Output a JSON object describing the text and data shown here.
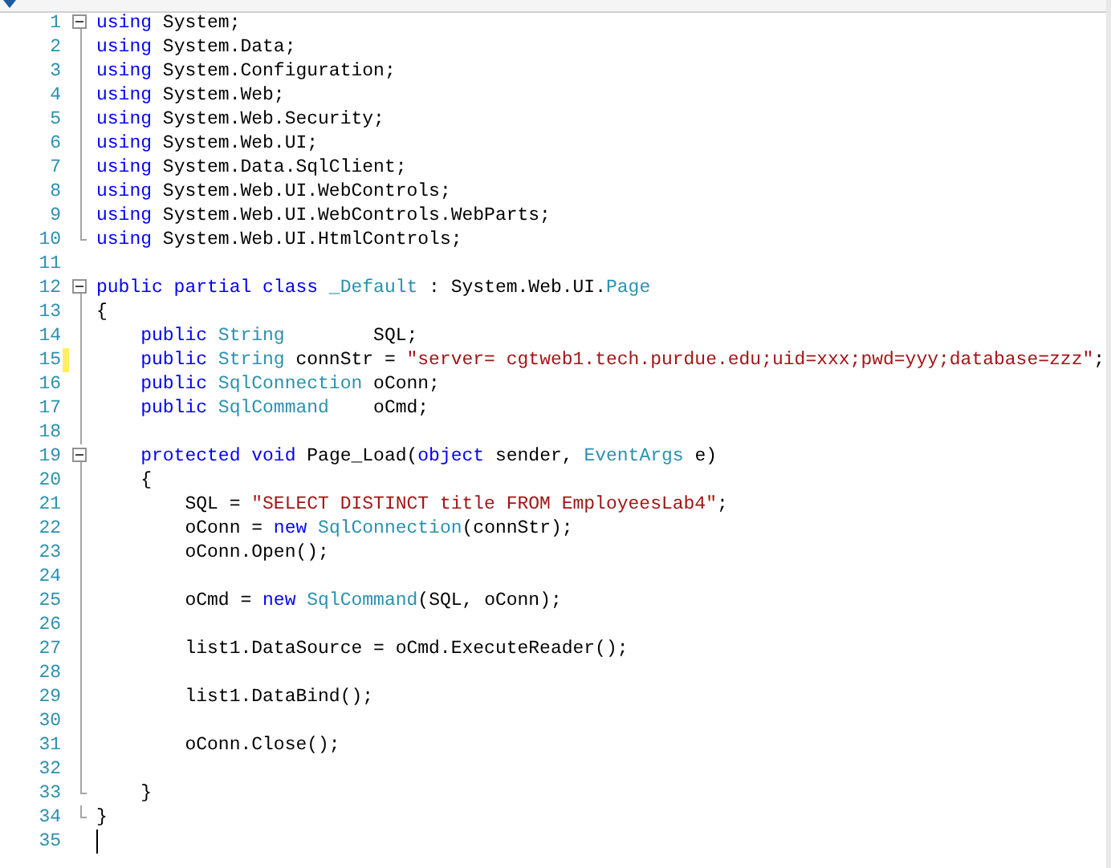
{
  "editor": {
    "lines": [
      {
        "number": "1",
        "kind": "start",
        "changed": false,
        "cursor": false,
        "tokens": [
          {
            "kind": "keyword",
            "text": "using"
          },
          {
            "kind": "plain",
            "text": " System;"
          }
        ]
      },
      {
        "number": "2",
        "kind": "body",
        "changed": false,
        "cursor": false,
        "tokens": [
          {
            "kind": "keyword",
            "text": "using"
          },
          {
            "kind": "plain",
            "text": " System.Data;"
          }
        ]
      },
      {
        "number": "3",
        "kind": "body",
        "changed": false,
        "cursor": false,
        "tokens": [
          {
            "kind": "keyword",
            "text": "using"
          },
          {
            "kind": "plain",
            "text": " System.Configuration;"
          }
        ]
      },
      {
        "number": "4",
        "kind": "body",
        "changed": false,
        "cursor": false,
        "tokens": [
          {
            "kind": "keyword",
            "text": "using"
          },
          {
            "kind": "plain",
            "text": " System.Web;"
          }
        ]
      },
      {
        "number": "5",
        "kind": "body",
        "changed": false,
        "cursor": false,
        "tokens": [
          {
            "kind": "keyword",
            "text": "using"
          },
          {
            "kind": "plain",
            "text": " System.Web.Security;"
          }
        ]
      },
      {
        "number": "6",
        "kind": "body",
        "changed": false,
        "cursor": false,
        "tokens": [
          {
            "kind": "keyword",
            "text": "using"
          },
          {
            "kind": "plain",
            "text": " System.Web.UI;"
          }
        ]
      },
      {
        "number": "7",
        "kind": "body",
        "changed": false,
        "cursor": false,
        "tokens": [
          {
            "kind": "keyword",
            "text": "using"
          },
          {
            "kind": "plain",
            "text": " System.Data.SqlClient;"
          }
        ]
      },
      {
        "number": "8",
        "kind": "body",
        "changed": false,
        "cursor": false,
        "tokens": [
          {
            "kind": "keyword",
            "text": "using"
          },
          {
            "kind": "plain",
            "text": " System.Web.UI.WebControls;"
          }
        ]
      },
      {
        "number": "9",
        "kind": "body",
        "changed": false,
        "cursor": false,
        "tokens": [
          {
            "kind": "keyword",
            "text": "using"
          },
          {
            "kind": "plain",
            "text": " System.Web.UI.WebControls.WebParts;"
          }
        ]
      },
      {
        "number": "10",
        "kind": "end",
        "changed": false,
        "cursor": false,
        "tokens": [
          {
            "kind": "keyword",
            "text": "using"
          },
          {
            "kind": "plain",
            "text": " System.Web.UI.HtmlControls;"
          }
        ]
      },
      {
        "number": "11",
        "kind": "plain",
        "changed": false,
        "cursor": false
      },
      {
        "number": "12",
        "kind": "start",
        "changed": false,
        "cursor": false,
        "tokens": [
          {
            "kind": "keyword",
            "text": "public partial class"
          },
          {
            "kind": "type",
            "text": " _Default"
          },
          {
            "kind": "plain",
            "text": " : System.Web.UI."
          },
          {
            "kind": "type",
            "text": "Page"
          }
        ]
      },
      {
        "number": "13",
        "kind": "body",
        "changed": false,
        "cursor": false,
        "tokens": [
          {
            "kind": "plain",
            "text": "{"
          }
        ]
      },
      {
        "number": "14",
        "kind": "body",
        "changed": false,
        "cursor": false,
        "tokens": [
          {
            "kind": "keyword",
            "text": "    public"
          },
          {
            "kind": "type",
            "text": " String"
          },
          {
            "kind": "plain",
            "text": "        SQL;"
          }
        ]
      },
      {
        "number": "15",
        "kind": "body",
        "changed": true,
        "cursor": false,
        "tokens": [
          {
            "kind": "keyword",
            "text": "    public"
          },
          {
            "kind": "type",
            "text": " String"
          },
          {
            "kind": "plain",
            "text": " connStr = "
          },
          {
            "kind": "string",
            "text": "\"server= cgtweb1.tech.purdue.edu;uid=xxx;pwd=yyy;database=zzz\""
          },
          {
            "kind": "plain",
            "text": ";"
          }
        ]
      },
      {
        "number": "16",
        "kind": "body",
        "changed": false,
        "cursor": false,
        "tokens": [
          {
            "kind": "keyword",
            "text": "    public"
          },
          {
            "kind": "type",
            "text": " SqlConnection"
          },
          {
            "kind": "plain",
            "text": " oConn;"
          }
        ]
      },
      {
        "number": "17",
        "kind": "body",
        "changed": false,
        "cursor": false,
        "tokens": [
          {
            "kind": "keyword",
            "text": "    public"
          },
          {
            "kind": "type",
            "text": " SqlCommand"
          },
          {
            "kind": "plain",
            "text": "    oCmd;"
          }
        ]
      },
      {
        "number": "18",
        "kind": "body",
        "changed": false,
        "cursor": false
      },
      {
        "number": "19",
        "kind": "start",
        "changed": false,
        "cursor": false,
        "tokens": [
          {
            "kind": "keyword",
            "text": "    protected void"
          },
          {
            "kind": "plain",
            "text": " Page_Load("
          },
          {
            "kind": "keyword",
            "text": "object"
          },
          {
            "kind": "plain",
            "text": " sender,"
          },
          {
            "kind": "type",
            "text": " EventArgs"
          },
          {
            "kind": "plain",
            "text": " e)"
          }
        ]
      },
      {
        "number": "20",
        "kind": "body",
        "changed": false,
        "cursor": false,
        "tokens": [
          {
            "kind": "plain",
            "text": "    {"
          }
        ]
      },
      {
        "number": "21",
        "kind": "body",
        "changed": false,
        "cursor": false,
        "tokens": [
          {
            "kind": "plain",
            "text": "        SQL = "
          },
          {
            "kind": "string",
            "text": "\"SELECT DISTINCT title FROM EmployeesLab4\""
          },
          {
            "kind": "plain",
            "text": ";"
          }
        ]
      },
      {
        "number": "22",
        "kind": "body",
        "changed": false,
        "cursor": false,
        "tokens": [
          {
            "kind": "plain",
            "text": "        oConn = "
          },
          {
            "kind": "keyword",
            "text": "new"
          },
          {
            "kind": "type",
            "text": " SqlConnection"
          },
          {
            "kind": "plain",
            "text": "(connStr);"
          }
        ]
      },
      {
        "number": "23",
        "kind": "body",
        "changed": false,
        "cursor": false,
        "tokens": [
          {
            "kind": "plain",
            "text": "        oConn.Open();"
          }
        ]
      },
      {
        "number": "24",
        "kind": "body",
        "changed": false,
        "cursor": false
      },
      {
        "number": "25",
        "kind": "body",
        "changed": false,
        "cursor": false,
        "tokens": [
          {
            "kind": "plain",
            "text": "        oCmd = "
          },
          {
            "kind": "keyword",
            "text": "new"
          },
          {
            "kind": "type",
            "text": " SqlCommand"
          },
          {
            "kind": "plain",
            "text": "(SQL, oConn);"
          }
        ]
      },
      {
        "number": "26",
        "kind": "body",
        "changed": false,
        "cursor": false
      },
      {
        "number": "27",
        "kind": "body",
        "changed": false,
        "cursor": false,
        "tokens": [
          {
            "kind": "plain",
            "text": "        list1.DataSource = oCmd.ExecuteReader();"
          }
        ]
      },
      {
        "number": "28",
        "kind": "body",
        "changed": false,
        "cursor": false
      },
      {
        "number": "29",
        "kind": "body",
        "changed": false,
        "cursor": false,
        "tokens": [
          {
            "kind": "plain",
            "text": "        list1.DataBind();"
          }
        ]
      },
      {
        "number": "30",
        "kind": "body",
        "changed": false,
        "cursor": false
      },
      {
        "number": "31",
        "kind": "body",
        "changed": false,
        "cursor": false,
        "tokens": [
          {
            "kind": "plain",
            "text": "        oConn.Close();"
          }
        ]
      },
      {
        "number": "32",
        "kind": "body",
        "changed": false,
        "cursor": false
      },
      {
        "number": "33",
        "kind": "end",
        "changed": false,
        "cursor": false,
        "tokens": [
          {
            "kind": "plain",
            "text": "    }"
          }
        ]
      },
      {
        "number": "34",
        "kind": "end",
        "changed": false,
        "cursor": false,
        "tokens": [
          {
            "kind": "plain",
            "text": "}"
          }
        ]
      },
      {
        "number": "35",
        "kind": "plain",
        "changed": false,
        "cursor": true
      }
    ]
  }
}
